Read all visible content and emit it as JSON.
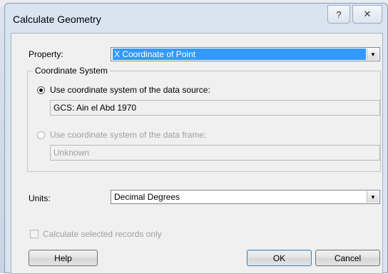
{
  "dialog": {
    "title": "Calculate Geometry",
    "help_glyph": "?",
    "close_glyph": "✕"
  },
  "property": {
    "label": "Property:",
    "value": "X Coordinate of Point"
  },
  "coordinate_system": {
    "group_title": "Coordinate System",
    "source_option": {
      "label": "Use coordinate system of the data source:",
      "selected": true,
      "value": "GCS: Ain el Abd 1970"
    },
    "frame_option": {
      "label": "Use coordinate system of the data frame:",
      "selected": false,
      "enabled": false,
      "value": "Unknown"
    }
  },
  "units": {
    "label": "Units:",
    "value": "Decimal Degrees"
  },
  "selected_only": {
    "label": "Calculate selected records only",
    "checked": false,
    "enabled": false
  },
  "buttons": {
    "help": "Help",
    "ok": "OK",
    "cancel": "Cancel"
  },
  "icons": {
    "dropdown": "chevron-down-icon",
    "help": "question-mark-icon",
    "close": "close-icon"
  },
  "colors": {
    "selection": "#3399ff",
    "window_frame": "#d9e4f1",
    "client_bg": "#f0f0f0"
  }
}
